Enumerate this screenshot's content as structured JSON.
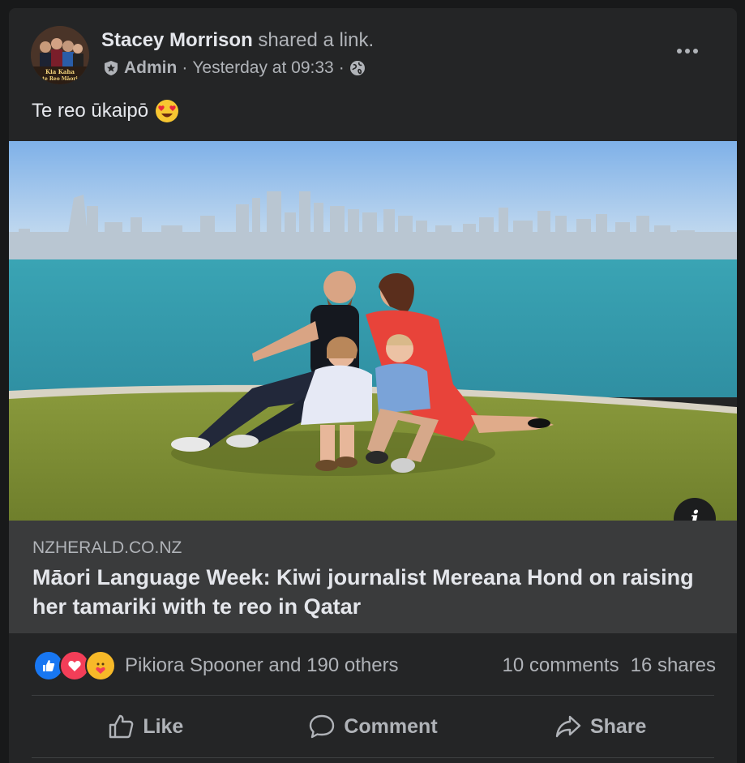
{
  "post": {
    "author": "Stacey Morrison",
    "action": "shared a link.",
    "role": "Admin",
    "separator": "·",
    "time": "Yesterday at 09:33",
    "text": "Te reo ūkaipō",
    "avatar_caption_line1": "Kia Kaha",
    "avatar_caption_line2": "te Reo Māori"
  },
  "link": {
    "domain": "NZHERALD.CO.NZ",
    "title": "Māori Language Week: Kiwi journalist Mereana Hond on raising her tamariki with te reo in Qatar",
    "info_glyph": "i"
  },
  "engagement": {
    "reactions_label": "Pikiora Spooner and 190 others",
    "comments": "10 comments",
    "shares": "16 shares"
  },
  "actions": {
    "like": "Like",
    "comment": "Comment",
    "share": "Share"
  },
  "icons": {
    "admin_badge": "shield-badge-icon",
    "audience": "globe-icon",
    "more": "more-dots-icon",
    "emoji": "heart-eyes-emoji",
    "reactions": [
      "like-reaction-icon",
      "love-reaction-icon",
      "care-reaction-icon"
    ]
  },
  "colors": {
    "background": "#18191a",
    "card": "#242526",
    "preview": "#3a3b3c",
    "like_blue": "#1877f2",
    "love_red": "#f33e58",
    "care_yellow": "#f7b928"
  }
}
